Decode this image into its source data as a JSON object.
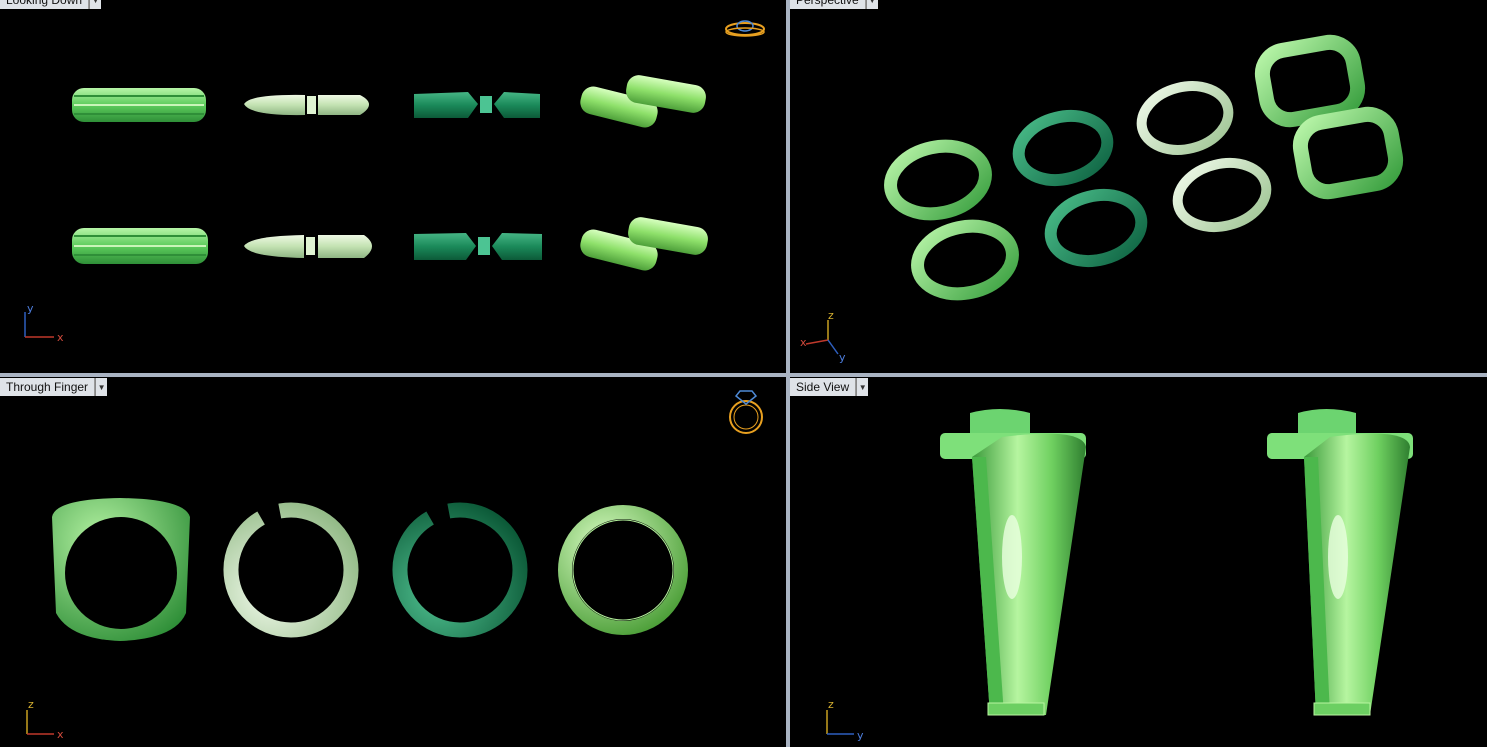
{
  "viewports": {
    "top_left": {
      "title": "Looking Down",
      "dropdown_icon": "chevron-down-icon",
      "axes": {
        "vertical": "y",
        "horizontal": "x"
      }
    },
    "top_right": {
      "title": "Perspective",
      "dropdown_icon": "chevron-down-icon",
      "axes": {
        "up": "z",
        "left": "x",
        "right": "y"
      }
    },
    "bottom_left": {
      "title": "Through Finger",
      "dropdown_icon": "chevron-down-icon",
      "axes": {
        "vertical": "z",
        "horizontal": "x"
      }
    },
    "bottom_right": {
      "title": "Side View",
      "dropdown_icon": "chevron-down-icon",
      "axes": {
        "vertical": "z",
        "horizontal": "y"
      }
    }
  },
  "colors": {
    "background": "#000000",
    "divider": "#a9b3c2",
    "ring_light_green": "#6fd86a",
    "ring_pale_green": "#c9e8bb",
    "ring_dark_green": "#1e8c5c",
    "ring_lime": "#9be86f",
    "axis_x": "#c0392b",
    "axis_y": "#2e5fbf",
    "axis_z": "#c8a020",
    "gizmo_gold": "#e8a020",
    "gizmo_blue": "#4e8ad6"
  },
  "icons": [
    "ring-orientation-gizmo-icon",
    "chevron-down-icon"
  ]
}
